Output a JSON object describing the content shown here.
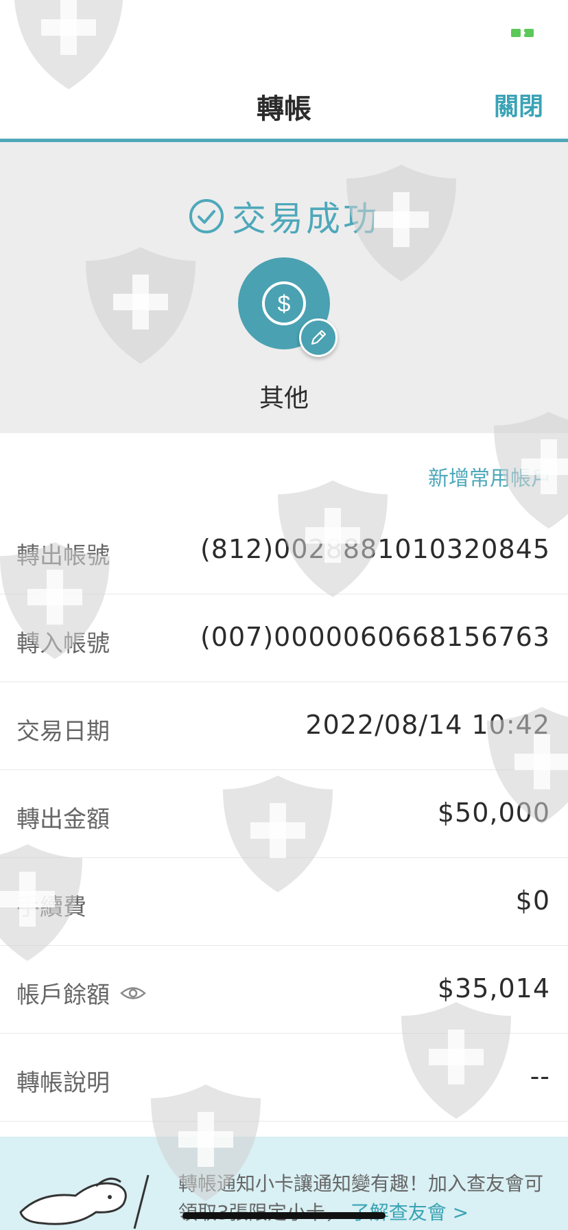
{
  "header": {
    "title": "轉帳",
    "close_label": "關閉"
  },
  "status": {
    "text": "交易成功",
    "color": "#4ea8ba"
  },
  "category": {
    "label": "其他",
    "icon": "dollar-icon"
  },
  "add_account_label": "新增常用帳戶",
  "details": [
    {
      "label": "轉出帳號",
      "value": "(812)0028881010320845"
    },
    {
      "label": "轉入帳號",
      "value": "(007)0000060668156763"
    },
    {
      "label": "交易日期",
      "value": "2022/08/14 10:42"
    },
    {
      "label": "轉出金額",
      "value": "$50,000"
    },
    {
      "label": "手續費",
      "value": "$0"
    },
    {
      "label": "帳戶餘額",
      "value": "$35,014",
      "icon": "eye-icon"
    },
    {
      "label": "轉帳說明",
      "value": "--"
    }
  ],
  "banner": {
    "text": "轉帳通知小卡讓通知變有趣！加入查友會可領取3張限定小卡，",
    "link": "了解查友會 >"
  },
  "colors": {
    "accent": "#4ea8ba",
    "panel": "#ededed",
    "banner": "#d9f0f4",
    "battery": "#5cc85a"
  }
}
